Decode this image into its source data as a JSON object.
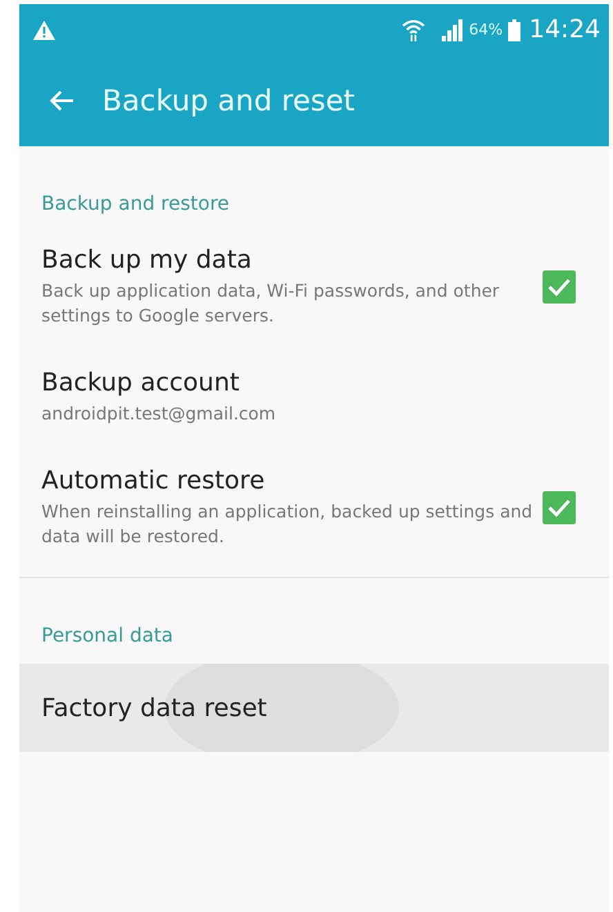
{
  "status_bar": {
    "battery": "64%",
    "time": "14:24"
  },
  "app_bar": {
    "title": "Backup and reset"
  },
  "sections": [
    {
      "header": "Backup and restore",
      "items": [
        {
          "kind": "checkbox",
          "title": "Back up my data",
          "summary": "Back up application data, Wi-Fi passwords, and other settings to Google servers.",
          "checked": true
        },
        {
          "kind": "text",
          "title": "Backup account",
          "summary": "androidpit.test@gmail.com"
        },
        {
          "kind": "checkbox",
          "title": "Automatic restore",
          "summary": "When reinstalling an application, backed up settings and data will be restored.",
          "checked": true
        }
      ]
    },
    {
      "header": "Personal data",
      "items": [
        {
          "kind": "text",
          "title": "Factory data reset",
          "pressed": true
        }
      ]
    }
  ]
}
